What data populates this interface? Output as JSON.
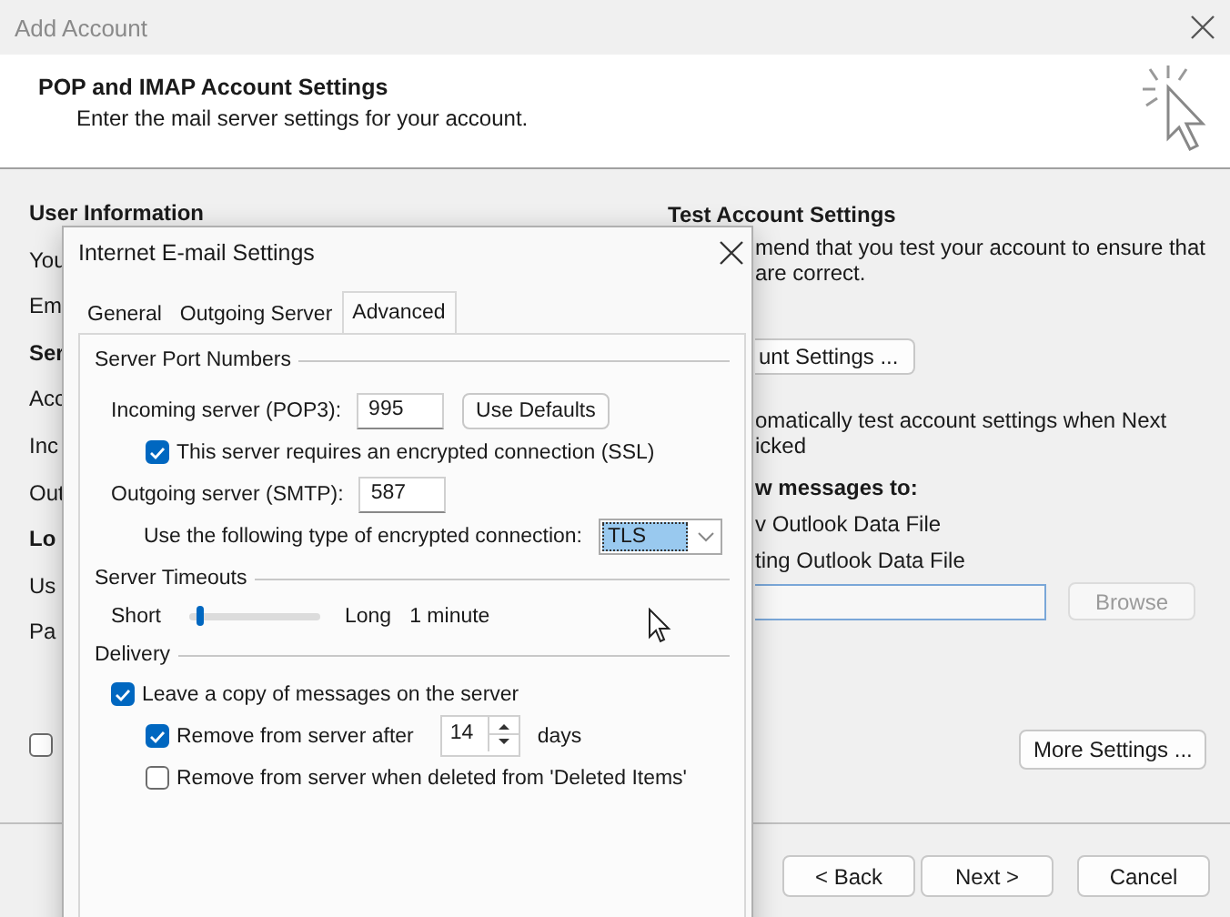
{
  "window": {
    "title": "Add Account"
  },
  "header": {
    "title": "POP and IMAP Account Settings",
    "subtitle": "Enter the mail server settings for your account."
  },
  "left_column": {
    "items": [
      {
        "text": "User Information",
        "kind": "heading"
      },
      {
        "text": "You",
        "kind": "label"
      },
      {
        "text": "Em",
        "kind": "label"
      },
      {
        "text": "Ser",
        "kind": "heading"
      },
      {
        "text": "Acc",
        "kind": "label"
      },
      {
        "text": "Inc",
        "kind": "label"
      },
      {
        "text": "Out",
        "kind": "label"
      },
      {
        "text": "Lo",
        "kind": "heading"
      },
      {
        "text": "Us",
        "kind": "label"
      },
      {
        "text": "Pa",
        "kind": "label"
      }
    ],
    "checkbox": {
      "checked": false
    }
  },
  "right_column": {
    "heading": "Test Account Settings",
    "description": [
      "mend that you test your account to ensure that",
      "are correct."
    ],
    "test_button": "unt Settings ...",
    "auto_test": [
      "omatically test account settings when Next",
      "icked"
    ],
    "deliver_heading": "w messages to:",
    "options": [
      "v Outlook Data File",
      "ting Outlook Data File"
    ],
    "browse_button": {
      "label": "Browse",
      "disabled": true
    },
    "more_settings_button": "More Settings ..."
  },
  "footer_buttons": [
    "< Back",
    "Next >",
    "Cancel"
  ],
  "dialog": {
    "title": "Internet E-mail Settings",
    "tabs": [
      {
        "label": "General",
        "selected": false
      },
      {
        "label": "Outgoing Server",
        "selected": false
      },
      {
        "label": "Advanced",
        "selected": true
      }
    ],
    "server_ports": {
      "title": "Server Port Numbers",
      "incoming_label": "Incoming server (POP3):",
      "incoming_port": "995",
      "use_defaults_button": "Use Defaults",
      "ssl": {
        "label": "This server requires an encrypted connection (SSL)",
        "checked": true
      },
      "outgoing_label": "Outgoing server (SMTP):",
      "outgoing_port": "587",
      "encryption_label": "Use the following type of encrypted connection:",
      "encryption": "TLS"
    },
    "timeouts": {
      "title": "Server Timeouts",
      "short_label": "Short",
      "level": 0.06,
      "long_label": "Long",
      "value": "1 minute"
    },
    "delivery": {
      "title": "Delivery",
      "leave_copy": {
        "label": "Leave a copy of messages on the server",
        "checked": true
      },
      "remove_after": {
        "label": "Remove from server after",
        "checked": true,
        "value": "14",
        "unit": "days"
      },
      "remove_deleted": {
        "label": "Remove from server when deleted from 'Deleted Items'",
        "checked": false
      }
    }
  }
}
